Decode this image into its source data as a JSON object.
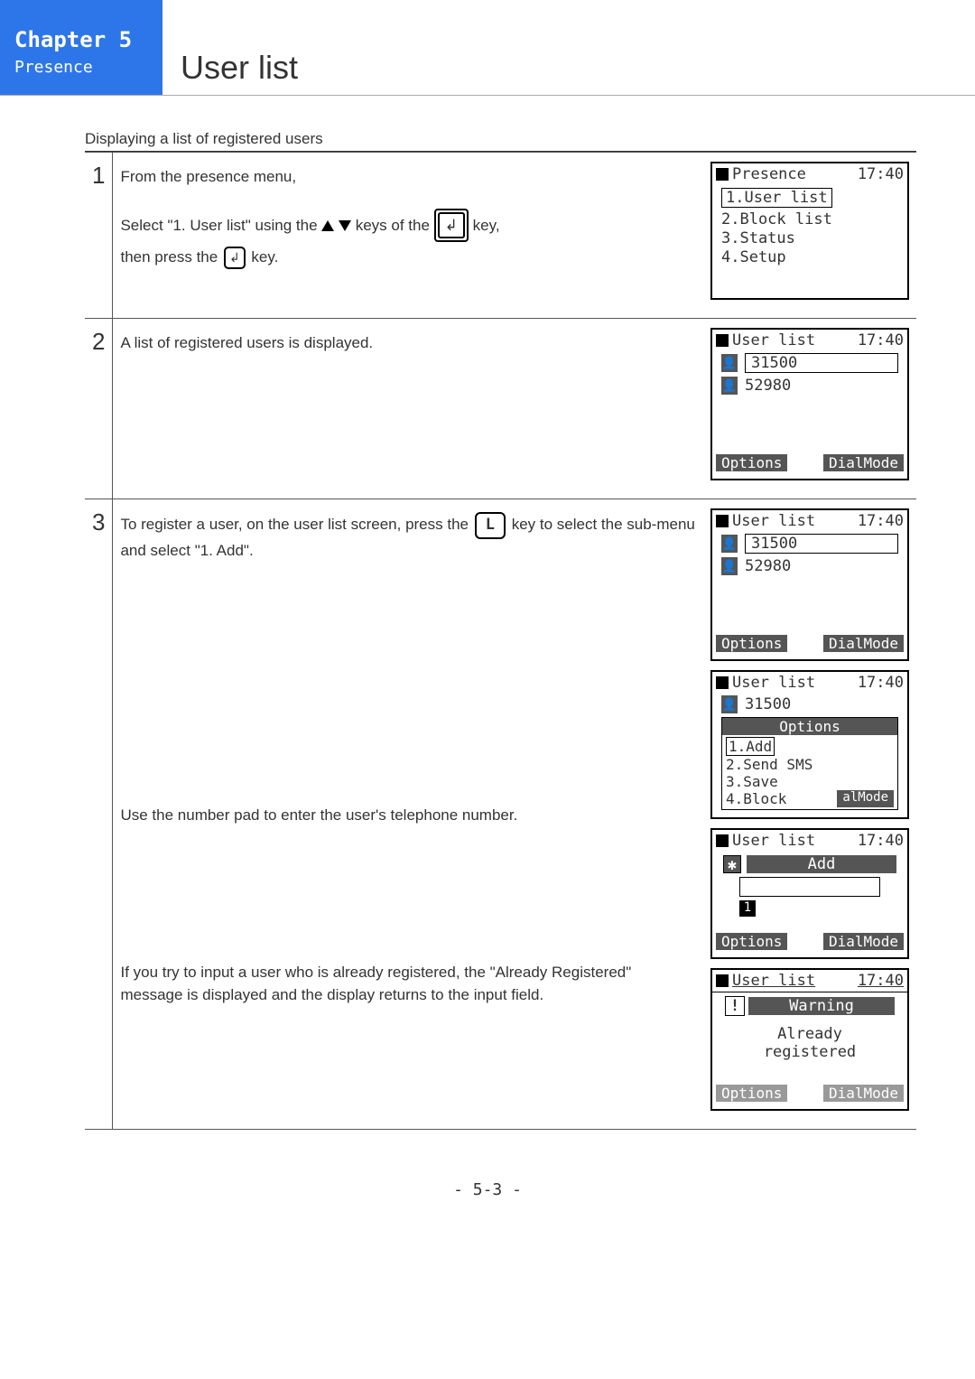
{
  "header": {
    "chapter": "Chapter 5",
    "section": "Presence",
    "title": "User list"
  },
  "subtitle": "Displaying a list of registered users",
  "steps": {
    "s1": {
      "num": "1",
      "line1": "From the presence menu,",
      "line2a": "Select \"1. User list\" using the ",
      "line2b": " keys of the ",
      "line2c": " key,",
      "line3a": "then press the ",
      "line3b": " key."
    },
    "s2": {
      "num": "2",
      "text": "A list of registered users is displayed."
    },
    "s3": {
      "num": "3",
      "part1a": "To register a user, on the user list screen, press the ",
      "part1b": " key to select the sub-menu and select \"1. Add\".",
      "part2": "Use the number pad to enter the user's telephone number.",
      "part3": "If you try to input a user who is already registered, the \"Already Registered\" message is displayed and the display returns to the input field."
    }
  },
  "screens": {
    "presence": {
      "title": "Presence",
      "time": "17:40",
      "m1": "1.User list",
      "m2": "2.Block list",
      "m3": "3.Status",
      "m4": "4.Setup"
    },
    "userlist": {
      "title": "User list",
      "time": "17:40",
      "u1": "31500",
      "u2": "52980",
      "options": "Options",
      "dialmode": "DialMode"
    },
    "options_menu": {
      "title": "User list",
      "time": "17:40",
      "u1": "31500",
      "opth": "Options",
      "o1": "1.Add",
      "o2": "2.Send SMS",
      "o3": "3.Save",
      "o4": "4.Block",
      "mode": "alMode"
    },
    "add": {
      "title": "User list",
      "time": "17:40",
      "add": "Add",
      "num": "1",
      "options": "Options",
      "dialmode": "DialMode"
    },
    "warning": {
      "title": "User list",
      "time": "17:40",
      "warn": "Warning",
      "msg1": "Already",
      "msg2": "registered",
      "options": "Options",
      "dialmode": "DialMode"
    }
  },
  "keys": {
    "L": "L",
    "enter": "↲"
  },
  "page": "- 5-3 -"
}
